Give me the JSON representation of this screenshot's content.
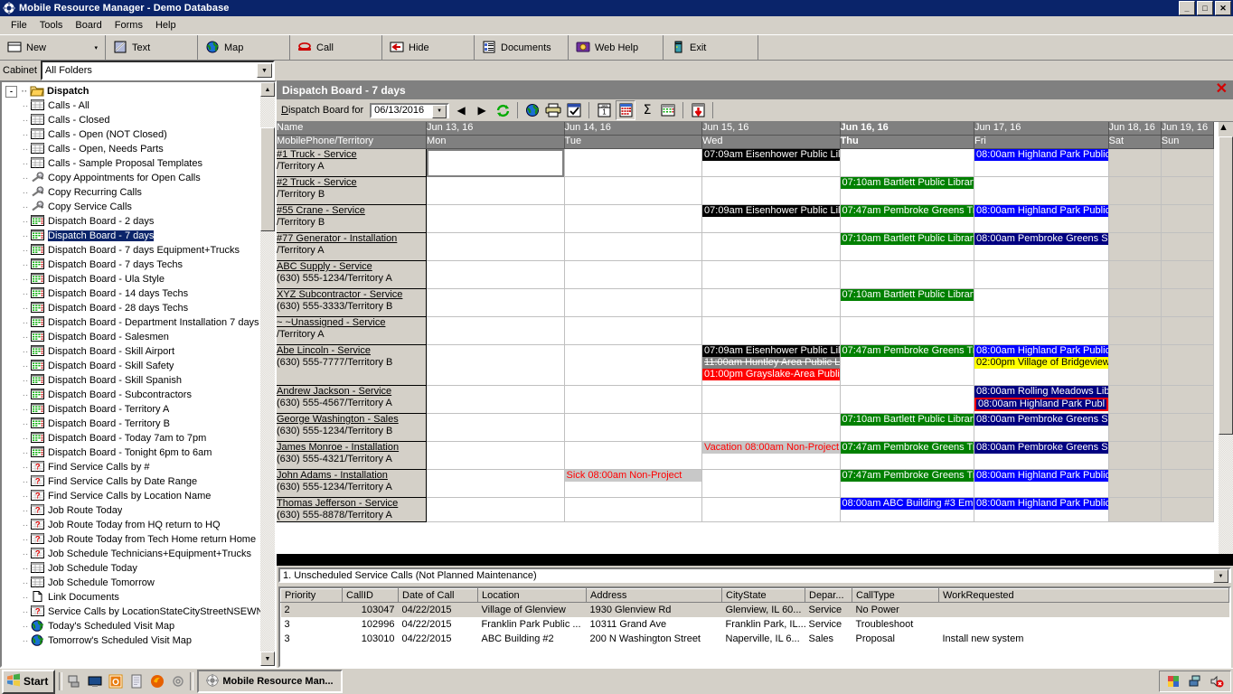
{
  "window": {
    "title": "Mobile Resource Manager - Demo Database",
    "icon": "gear-icon",
    "minimize": "_",
    "maximize": "□",
    "close": "✕"
  },
  "menu": [
    "File",
    "Tools",
    "Board",
    "Forms",
    "Help"
  ],
  "toolbar": [
    {
      "label": "New",
      "icon": "new-window-icon",
      "dropdown": "▾"
    },
    {
      "label": "Text",
      "icon": "text-icon"
    },
    {
      "label": "Map",
      "icon": "globe-icon"
    },
    {
      "label": "Call",
      "icon": "phone-icon"
    },
    {
      "label": "Hide",
      "icon": "arrow-left-icon"
    },
    {
      "label": "Documents",
      "icon": "documents-icon"
    },
    {
      "label": "Web Help",
      "icon": "book-icon"
    },
    {
      "label": "Exit",
      "icon": "door-icon"
    }
  ],
  "cabinet": {
    "label": "Cabinet",
    "value": "All Folders",
    "arrow": "▼"
  },
  "tree": {
    "root": {
      "label": "Dispatch",
      "expander": "-",
      "icon": "folder-open-icon"
    },
    "items": [
      {
        "label": "Calls - All",
        "icon": "grid-icon"
      },
      {
        "label": "Calls - Closed",
        "icon": "grid-icon"
      },
      {
        "label": "Calls - Open (NOT Closed)",
        "icon": "grid-icon"
      },
      {
        "label": "Calls - Open, Needs Parts",
        "icon": "grid-icon"
      },
      {
        "label": "Calls - Sample Proposal Templates",
        "icon": "grid-icon"
      },
      {
        "label": "Copy Appointments for Open Calls",
        "icon": "wrench-icon"
      },
      {
        "label": "Copy Recurring Calls",
        "icon": "wrench-icon"
      },
      {
        "label": "Copy Service Calls",
        "icon": "wrench-icon"
      },
      {
        "label": "Dispatch Board -  2 days",
        "icon": "board-icon"
      },
      {
        "label": "Dispatch Board -  7 days",
        "icon": "board-icon",
        "selected": true
      },
      {
        "label": "Dispatch Board -  7 days Equipment+Trucks",
        "icon": "board-icon"
      },
      {
        "label": "Dispatch Board -  7 days Techs",
        "icon": "board-icon"
      },
      {
        "label": "Dispatch Board -  Ula Style",
        "icon": "board-icon"
      },
      {
        "label": "Dispatch Board - 14 days Techs",
        "icon": "board-icon"
      },
      {
        "label": "Dispatch Board - 28 days Techs",
        "icon": "board-icon"
      },
      {
        "label": "Dispatch Board - Department Installation 7 days",
        "icon": "board-icon"
      },
      {
        "label": "Dispatch Board - Salesmen",
        "icon": "board-icon"
      },
      {
        "label": "Dispatch Board - Skill Airport",
        "icon": "board-icon"
      },
      {
        "label": "Dispatch Board - Skill Safety",
        "icon": "board-icon"
      },
      {
        "label": "Dispatch Board - Skill Spanish",
        "icon": "board-icon"
      },
      {
        "label": "Dispatch Board - Subcontractors",
        "icon": "board-icon"
      },
      {
        "label": "Dispatch Board - Territory A",
        "icon": "board-icon"
      },
      {
        "label": "Dispatch Board - Territory B",
        "icon": "board-icon"
      },
      {
        "label": "Dispatch Board - Today 7am to 7pm",
        "icon": "board-icon"
      },
      {
        "label": "Dispatch Board - Tonight 6pm to 6am",
        "icon": "board-icon"
      },
      {
        "label": "Find Service Calls by #",
        "icon": "query-icon"
      },
      {
        "label": "Find Service Calls by Date Range",
        "icon": "query-icon"
      },
      {
        "label": "Find Service Calls by Location Name",
        "icon": "query-icon"
      },
      {
        "label": "Job Route Today",
        "icon": "query-icon"
      },
      {
        "label": "Job Route Today from HQ return to HQ",
        "icon": "query-icon"
      },
      {
        "label": "Job Route Today from Tech Home return Home",
        "icon": "query-icon"
      },
      {
        "label": "Job Schedule Technicians+Equipment+Trucks",
        "icon": "query-icon"
      },
      {
        "label": "Job Schedule Today",
        "icon": "grid-icon"
      },
      {
        "label": "Job Schedule Tomorrow",
        "icon": "grid-icon"
      },
      {
        "label": "Link Documents",
        "icon": "document-icon"
      },
      {
        "label": "Service Calls by LocationStateCityStreetNSEWN",
        "icon": "query-icon"
      },
      {
        "label": "Today's Scheduled Visit Map",
        "icon": "globe-icon"
      },
      {
        "label": "Tomorrow's Scheduled Visit Map",
        "icon": "globe-icon"
      }
    ]
  },
  "board": {
    "title": "Dispatch Board -  7 days",
    "close": "✕",
    "date_label": "Dispatch Board for",
    "date_value": "06/13/2016",
    "nav_prev": "◀",
    "nav_next": "▶",
    "tools": [
      {
        "icon": "refresh-icon"
      },
      {
        "icon": "globe-icon"
      },
      {
        "icon": "printer-icon"
      },
      {
        "icon": "checklist-icon"
      },
      {
        "icon": "calendar-day-icon"
      },
      {
        "icon": "calendar-month-icon",
        "pressed": true
      },
      {
        "icon": "sigma-icon"
      },
      {
        "icon": "grid-icon"
      },
      {
        "icon": "export-down-icon"
      }
    ],
    "columns": [
      {
        "date": "",
        "day": "",
        "name_header": "Name",
        "sub_header": "MobilePhone/Territory",
        "is_name": true
      },
      {
        "date": "Jun 13, 16",
        "day": "Mon"
      },
      {
        "date": "Jun 14, 16",
        "day": "Tue"
      },
      {
        "date": "Jun 15, 16",
        "day": "Wed"
      },
      {
        "date": "Jun 16, 16",
        "day": "Thu",
        "bold": true
      },
      {
        "date": "Jun 17, 16",
        "day": "Fri"
      },
      {
        "date": "Jun 18, 16",
        "day": "Sat",
        "weekend": true
      },
      {
        "date": "Jun 19, 16",
        "day": "Sun",
        "weekend": true
      }
    ],
    "rows": [
      {
        "name": "#1 Truck - Service",
        "sub": "/Territory A",
        "mon": [],
        "tue": [],
        "wed": [
          {
            "text": "07:09am Eisenhower Public Lil",
            "style": "black"
          }
        ],
        "thu": [],
        "fri": [
          {
            "text": "08:00am Highland Park Public",
            "style": "blue"
          }
        ],
        "sat": [],
        "sun": []
      },
      {
        "name": "#2 Truck - Service",
        "sub": "/Territory B",
        "mon": [],
        "tue": [],
        "wed": [],
        "thu": [
          {
            "text": "07:10am Bartlett Public Library",
            "style": "green"
          }
        ],
        "fri": [],
        "sat": [],
        "sun": []
      },
      {
        "name": "#55 Crane - Service",
        "sub": "/Territory B",
        "mon": [],
        "tue": [],
        "wed": [
          {
            "text": "07:09am Eisenhower Public Lil",
            "style": "black"
          }
        ],
        "thu": [
          {
            "text": "07:47am Pembroke Greens Tr",
            "style": "green"
          }
        ],
        "fri": [
          {
            "text": "08:00am Highland Park Public",
            "style": "blue"
          }
        ],
        "sat": [],
        "sun": []
      },
      {
        "name": "#77 Generator - Installation",
        "sub": "/Territory A",
        "mon": [],
        "tue": [],
        "wed": [],
        "thu": [
          {
            "text": "07:10am Bartlett Public Library",
            "style": "green"
          }
        ],
        "fri": [
          {
            "text": "08:00am Pembroke Greens Sy",
            "style": "navy"
          }
        ],
        "sat": [],
        "sun": []
      },
      {
        "name": " ABC Supply - Service",
        "sub": "(630) 555-1234/Territory A",
        "mon": [],
        "tue": [],
        "wed": [],
        "thu": [],
        "fri": [],
        "sat": [],
        "sun": []
      },
      {
        "name": "XYZ Subcontractor - Service",
        "sub": "(630) 555-3333/Territory B",
        "mon": [],
        "tue": [],
        "wed": [],
        "thu": [
          {
            "text": "07:10am Bartlett Public Library",
            "style": "green"
          }
        ],
        "fri": [],
        "sat": [],
        "sun": []
      },
      {
        "name": "~ ~Unassigned - Service",
        "sub": "/Territory A",
        "mon": [],
        "tue": [],
        "wed": [],
        "thu": [],
        "fri": [],
        "sat": [],
        "sun": []
      },
      {
        "name": "Abe Lincoln - Service",
        "sub": "(630) 555-7777/Territory B",
        "mon": [],
        "tue": [],
        "wed": [
          {
            "text": "07:09am Eisenhower Public Lil",
            "style": "black"
          },
          {
            "text": "11:00am Huntley Area Public L",
            "style": "gray-strike"
          },
          {
            "text": "01:00pm Grayslake-Area Publi",
            "style": "red"
          }
        ],
        "thu": [
          {
            "text": "07:47am Pembroke Greens Tr",
            "style": "green"
          }
        ],
        "fri": [
          {
            "text": "08:00am Highland Park Public",
            "style": "blue"
          },
          {
            "text": "02:00pm Village of Bridgeview",
            "style": "yellow"
          }
        ],
        "sat": [],
        "sun": [],
        "tall": true
      },
      {
        "name": "Andrew Jackson - Service",
        "sub": "(630) 555-4567/Territory A",
        "mon": [],
        "tue": [],
        "wed": [],
        "thu": [],
        "fri": [
          {
            "text": "08:00am Rolling Meadows Lib",
            "style": "navy"
          },
          {
            "text": "08:00am Highland Park Publ",
            "style": "navy outline-red"
          }
        ],
        "sat": [],
        "sun": []
      },
      {
        "name": "George Washington - Sales",
        "sub": "(630) 555-1234/Territory B",
        "mon": [],
        "tue": [],
        "wed": [],
        "thu": [
          {
            "text": "07:10am Bartlett Public Library",
            "style": "green"
          }
        ],
        "fri": [
          {
            "text": "08:00am Pembroke Greens Sy",
            "style": "navy"
          }
        ],
        "sat": [],
        "sun": []
      },
      {
        "name": "James Monroe - Installation",
        "sub": "(630) 555-4321/Territory A",
        "mon": [],
        "tue": [],
        "wed": [
          {
            "text": "Vacation 08:00am Non-Project",
            "style": "np"
          }
        ],
        "thu": [
          {
            "text": "07:47am Pembroke Greens Tr",
            "style": "green"
          }
        ],
        "fri": [
          {
            "text": "08:00am Pembroke Greens Sy",
            "style": "navy"
          }
        ],
        "sat": [],
        "sun": []
      },
      {
        "name": "John Adams - Installation",
        "sub": "(630) 555-1234/Territory A",
        "mon": [],
        "tue": [
          {
            "text": "Sick 08:00am Non-Project",
            "style": "np"
          }
        ],
        "wed": [],
        "thu": [
          {
            "text": "07:47am Pembroke Greens Tr",
            "style": "green"
          }
        ],
        "fri": [
          {
            "text": "08:00am Highland Park Public",
            "style": "blue"
          }
        ],
        "sat": [],
        "sun": []
      },
      {
        "name": "Thomas Jefferson - Service",
        "sub": "(630) 555-8878/Territory A",
        "mon": [],
        "tue": [],
        "wed": [],
        "thu": [
          {
            "text": "08:00am ABC Building #3 Eme",
            "style": "blue"
          }
        ],
        "fri": [
          {
            "text": "08:00am Highland Park Public",
            "style": "blue"
          }
        ],
        "sat": [],
        "sun": [],
        "clipped": true
      }
    ]
  },
  "unscheduled": {
    "title": "1. Unscheduled Service Calls (Not Planned Maintenance)",
    "arrow": "▼",
    "columns": [
      "Priority",
      "CallID",
      "Date of Call",
      "Location",
      "Address",
      "CityState",
      "Depar...",
      "CallType",
      "WorkRequested"
    ],
    "rows": [
      {
        "priority": "2",
        "callid": "103047",
        "date": "04/22/2015",
        "location": "Village of Glenview",
        "address": "1930 Glenview Rd",
        "citystate": "Glenview, IL  60...",
        "department": "Service",
        "calltype": "No Power",
        "work": "",
        "selected": true
      },
      {
        "priority": "3",
        "callid": "102996",
        "date": "04/22/2015",
        "location": "Franklin Park Public ...",
        "address": "10311 Grand Ave",
        "citystate": "Franklin Park, IL...",
        "department": "Service",
        "calltype": "Troubleshoot",
        "work": ""
      },
      {
        "priority": "3",
        "callid": "103010",
        "date": "04/22/2015",
        "location": "ABC Building #2",
        "address": "200 N Washington Street",
        "citystate": "Naperville, IL  6...",
        "department": "Sales",
        "calltype": "Proposal",
        "work": "Install new system"
      }
    ]
  },
  "taskbar": {
    "start": "Start",
    "quicklaunch": [
      "desktop-icon",
      "monitor-icon",
      "outlook-icon",
      "notepad-icon",
      "firefox-icon",
      "settings-icon"
    ],
    "task": {
      "label": "Mobile Resource Man...",
      "icon": "gear-icon"
    },
    "tray": [
      "colors-icon",
      "network-icon",
      "volume-mute-icon"
    ]
  },
  "colors": {
    "titlebar": "#0a246a",
    "chrome": "#d4d0c8",
    "header": "#808080",
    "appt_green": "#008000",
    "appt_blue": "#0000ff",
    "appt_navy": "#000080",
    "appt_black": "#000000",
    "appt_red": "#ff0000",
    "appt_yellow": "#ffff00"
  }
}
